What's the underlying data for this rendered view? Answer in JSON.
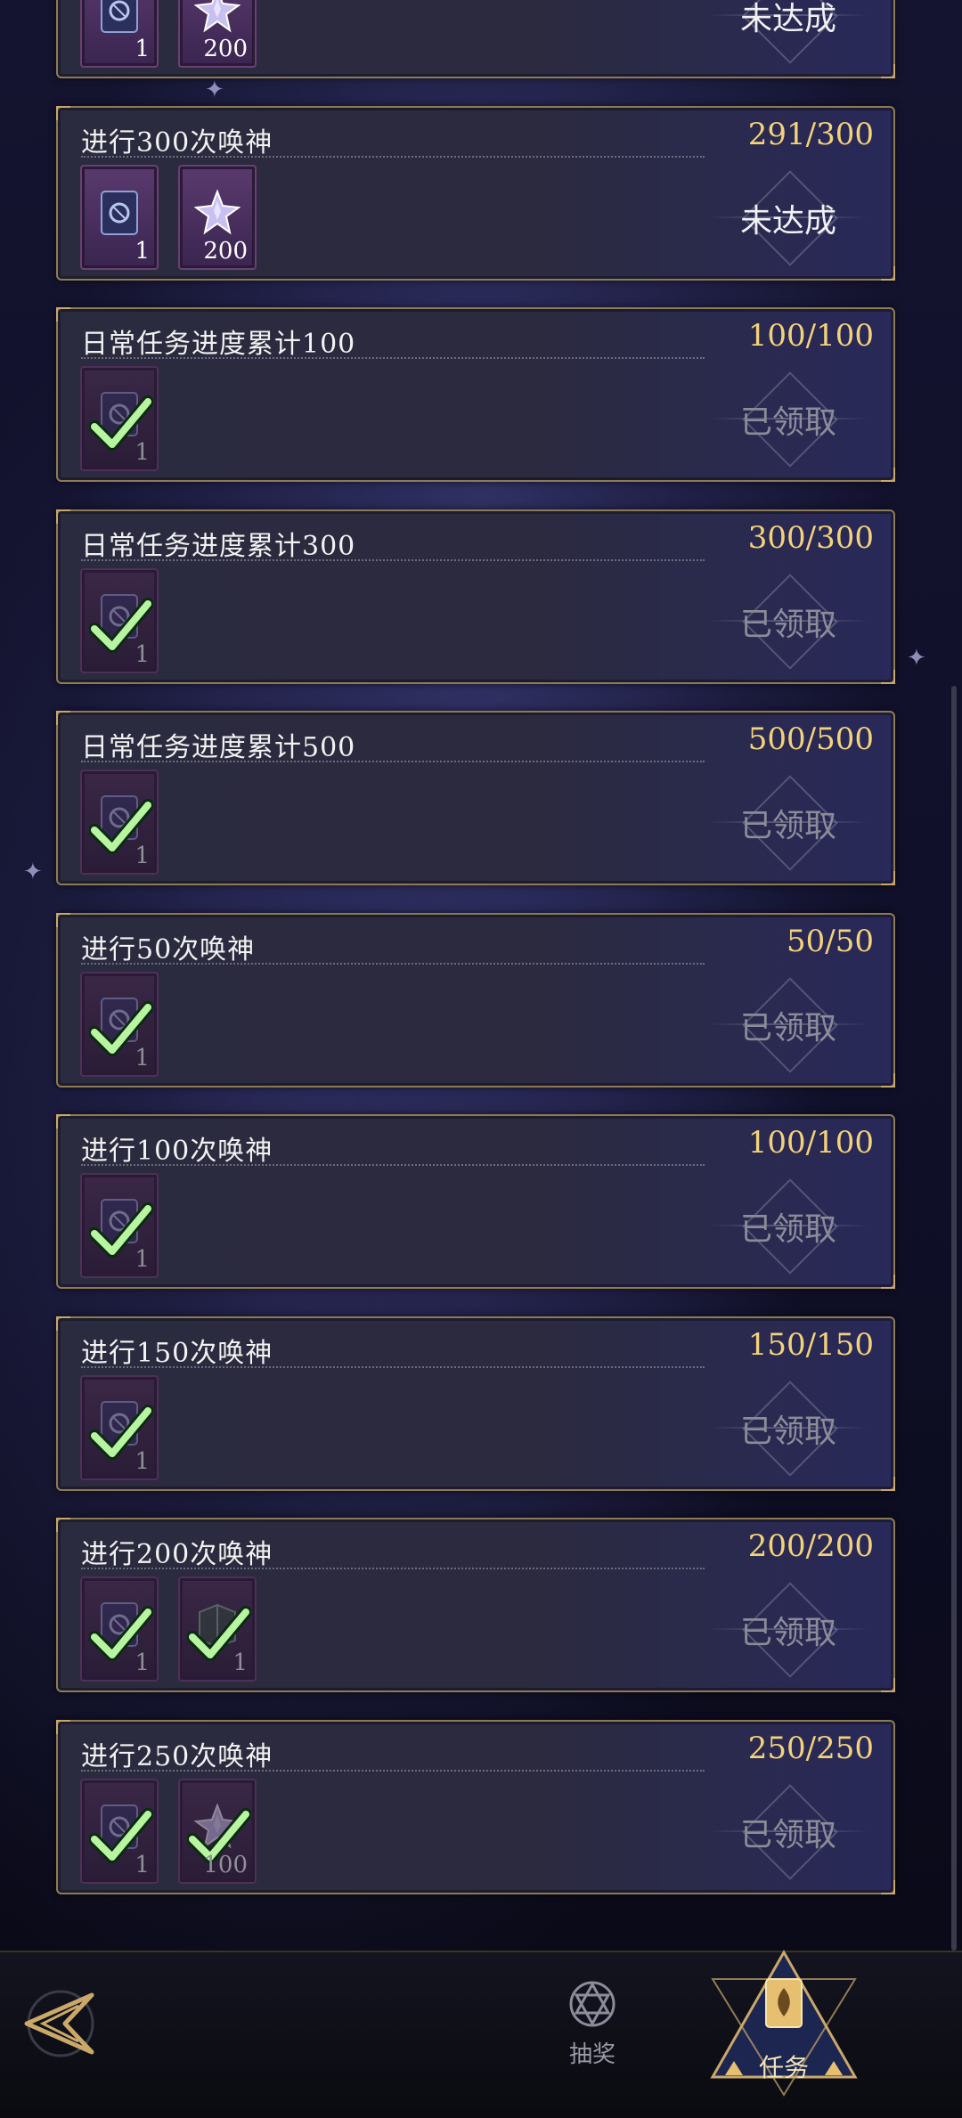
{
  "tasks": [
    {
      "title": "",
      "progress": "",
      "status": "未达成",
      "state": "pending",
      "rewards": [
        {
          "icon": "card-icon",
          "count": "1",
          "claimed": false
        },
        {
          "icon": "star-crystal-icon",
          "count": "200",
          "claimed": false
        }
      ]
    },
    {
      "title": "进行300次唤神",
      "progress": "291/300",
      "status": "未达成",
      "state": "pending",
      "rewards": [
        {
          "icon": "card-icon",
          "count": "1",
          "claimed": false
        },
        {
          "icon": "star-crystal-icon",
          "count": "200",
          "claimed": false
        }
      ]
    },
    {
      "title": "日常任务进度累计100",
      "progress": "100/100",
      "status": "已领取",
      "state": "done",
      "rewards": [
        {
          "icon": "card-icon",
          "count": "1",
          "claimed": true
        }
      ]
    },
    {
      "title": "日常任务进度累计300",
      "progress": "300/300",
      "status": "已领取",
      "state": "done",
      "rewards": [
        {
          "icon": "card-icon",
          "count": "1",
          "claimed": true
        }
      ]
    },
    {
      "title": "日常任务进度累计500",
      "progress": "500/500",
      "status": "已领取",
      "state": "done",
      "rewards": [
        {
          "icon": "card-icon",
          "count": "1",
          "claimed": true
        }
      ]
    },
    {
      "title": "进行50次唤神",
      "progress": "50/50",
      "status": "已领取",
      "state": "done",
      "rewards": [
        {
          "icon": "card-icon",
          "count": "1",
          "claimed": true
        }
      ]
    },
    {
      "title": "进行100次唤神",
      "progress": "100/100",
      "status": "已领取",
      "state": "done",
      "rewards": [
        {
          "icon": "card-icon",
          "count": "1",
          "claimed": true
        }
      ]
    },
    {
      "title": "进行150次唤神",
      "progress": "150/150",
      "status": "已领取",
      "state": "done",
      "rewards": [
        {
          "icon": "card-icon",
          "count": "1",
          "claimed": true
        }
      ]
    },
    {
      "title": "进行200次唤神",
      "progress": "200/200",
      "status": "已领取",
      "state": "done",
      "rewards": [
        {
          "icon": "card-icon",
          "count": "1",
          "claimed": true
        },
        {
          "icon": "book-icon",
          "count": "1",
          "claimed": true
        }
      ]
    },
    {
      "title": "进行250次唤神",
      "progress": "250/250",
      "status": "已领取",
      "state": "done",
      "rewards": [
        {
          "icon": "card-icon",
          "count": "1",
          "claimed": true
        },
        {
          "icon": "star-crystal-icon",
          "count": "100",
          "claimed": true
        }
      ]
    }
  ],
  "nav": {
    "draw_label": "抽奖",
    "task_label": "任务"
  },
  "colors": {
    "progress": "#f3d27a",
    "check": "#b8f5a0",
    "accent_gold": "#c9a86a"
  }
}
